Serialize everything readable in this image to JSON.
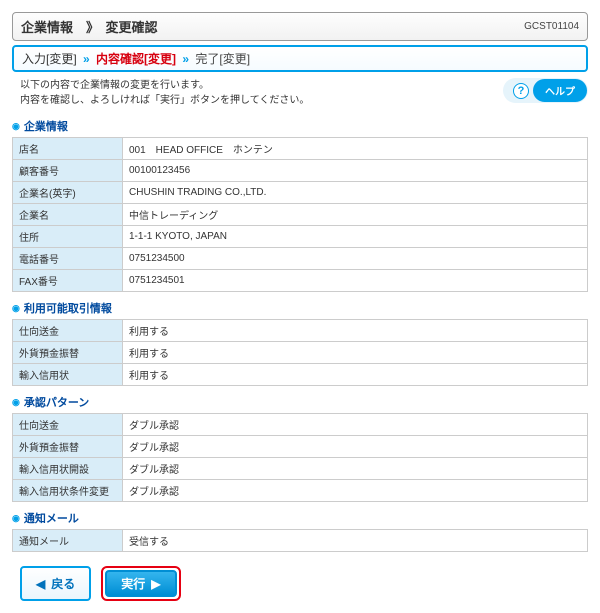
{
  "header": {
    "title": "企業情報　》　変更確認",
    "screenCode": "GCST01104"
  },
  "breadcrumb": {
    "s1": "入力[変更]",
    "s2": "内容確認[変更]",
    "s3": "完了[変更]",
    "sep": "»"
  },
  "message": {
    "l1": "以下の内容で企業情報の変更を行います。",
    "l2": "内容を確認し、よろしければ「実行」ボタンを押してください。"
  },
  "help": {
    "q": "?",
    "label": "ヘルプ"
  },
  "sec1": {
    "h": "企業情報",
    "rows": [
      {
        "k": "店名",
        "v": "001　HEAD OFFICE　ホンテン"
      },
      {
        "k": "顧客番号",
        "v": "00100123456"
      },
      {
        "k": "企業名(英字)",
        "v": "CHUSHIN TRADING CO.,LTD."
      },
      {
        "k": "企業名",
        "v": "中信トレーディング"
      },
      {
        "k": "住所",
        "v": "1-1-1 KYOTO, JAPAN"
      },
      {
        "k": "電話番号",
        "v": "0751234500"
      },
      {
        "k": "FAX番号",
        "v": "0751234501"
      }
    ]
  },
  "sec2": {
    "h": "利用可能取引情報",
    "rows": [
      {
        "k": "仕向送金",
        "v": "利用する"
      },
      {
        "k": "外貨預金振替",
        "v": "利用する"
      },
      {
        "k": "輸入信用状",
        "v": "利用する"
      }
    ]
  },
  "sec3": {
    "h": "承認パターン",
    "rows": [
      {
        "k": "仕向送金",
        "v": "ダブル承認"
      },
      {
        "k": "外貨預金振替",
        "v": "ダブル承認"
      },
      {
        "k": "輸入信用状開設",
        "v": "ダブル承認"
      },
      {
        "k": "輸入信用状条件変更",
        "v": "ダブル承認"
      }
    ]
  },
  "sec4": {
    "h": "通知メール",
    "rows": [
      {
        "k": "通知メール",
        "v": "受信する"
      }
    ]
  },
  "buttons": {
    "back": "戻る",
    "execute": "実行",
    "la": "◀",
    "ra": "▶"
  }
}
